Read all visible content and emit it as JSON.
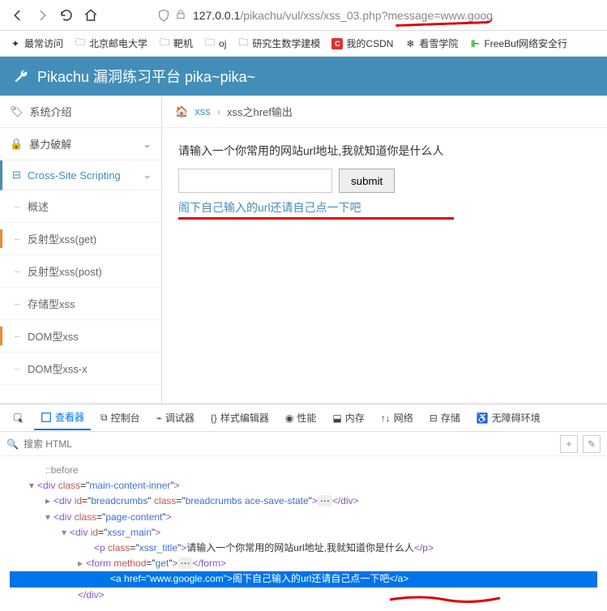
{
  "browser": {
    "url_prefix": "127.0.0.1",
    "url_path": "/pikachu/vul/xss/xss_03.php?message=www.goog"
  },
  "bookmarks": {
    "most": "最常访问",
    "items": [
      "北京邮电大学",
      "靶机",
      "oj",
      "研究生数学建模",
      "我的CSDN",
      "看雪学院",
      "FreeBuf网络安全行"
    ]
  },
  "app": {
    "title": "Pikachu 漏洞练习平台 pika~pika~"
  },
  "sidebar": {
    "items": [
      {
        "label": "系统介绍"
      },
      {
        "label": "暴力破解"
      },
      {
        "label": "Cross-Site Scripting"
      },
      {
        "label": "概述"
      },
      {
        "label": "反射型xss(get)"
      },
      {
        "label": "反射型xss(post)"
      },
      {
        "label": "存储型xss"
      },
      {
        "label": "DOM型xss"
      },
      {
        "label": "DOM型xss-x"
      }
    ]
  },
  "breadcrumb": {
    "home": "xss",
    "current": "xss之href输出"
  },
  "content": {
    "prompt": "请输入一个你常用的网站url地址,我就知道你是什么人",
    "submit": "submit",
    "link": "阁下自己输入的url还请自己点一下吧"
  },
  "devtools": {
    "tabs": [
      "查看器",
      "控制台",
      "调试器",
      "样式编辑器",
      "性能",
      "内存",
      "网络",
      "存储",
      "无障碍环境"
    ],
    "search_placeholder": "搜索 HTML",
    "dom": {
      "before": "::before",
      "div1": "main-content-inner",
      "bc_id": "breadcrumbs",
      "bc_cls": "breadcrumbs ace-save-state",
      "pc": "page-content",
      "xssr": "xssr_main",
      "p_cls": "xssr_title",
      "p_txt": "请输入一个你常用的网站url地址,我就知道你是什么人",
      "form_m": "get",
      "a_href": "www.google.com",
      "a_txt": "阁下自己输入的url还请自己点一下吧"
    }
  }
}
